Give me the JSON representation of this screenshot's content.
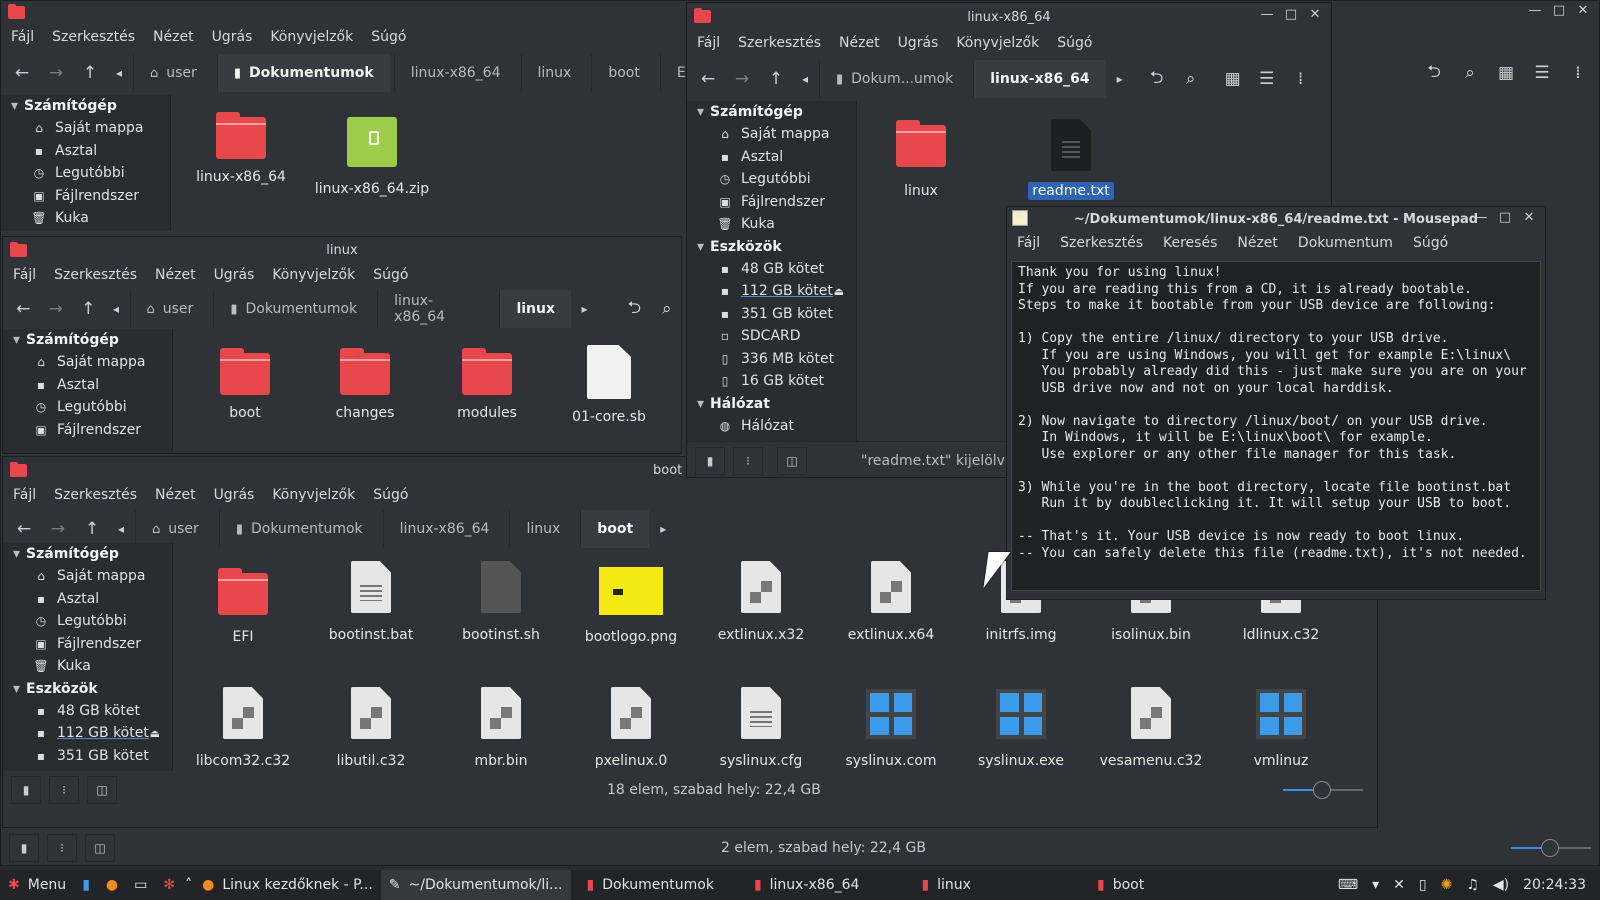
{
  "menus": [
    "Fájl",
    "Szerkesztés",
    "Nézet",
    "Ugrás",
    "Könyvjelzők",
    "Súgó"
  ],
  "win_back": {
    "path": [
      "user",
      "Dokumentumok",
      "linux-x86_64",
      "linux",
      "boot",
      "EFI"
    ],
    "sidebar": {
      "section": "Számítógép",
      "items": [
        "Saját mappa",
        "Asztal",
        "Legutóbbi",
        "Fájlrendszer",
        "Kuka"
      ]
    },
    "files": [
      {
        "name": "linux-x86_64",
        "type": "folder"
      },
      {
        "name": "linux-x86_64.zip",
        "type": "zip"
      }
    ],
    "status": "2 elem, szabad hely: 22,4 GB"
  },
  "win_linux": {
    "title": "linux",
    "path": [
      "user",
      "Dokumentumok",
      "linux-x86_64",
      "linux"
    ],
    "sidebar": {
      "section": "Számítógép",
      "items": [
        "Saját mappa",
        "Asztal",
        "Legutóbbi",
        "Fájlrendszer"
      ]
    },
    "files": [
      {
        "name": "boot",
        "type": "folder"
      },
      {
        "name": "changes",
        "type": "folder"
      },
      {
        "name": "modules",
        "type": "folder"
      },
      {
        "name": "01-core.sb",
        "type": "blank"
      }
    ]
  },
  "win_boot": {
    "title": "boot",
    "path": [
      "user",
      "Dokumentumok",
      "linux-x86_64",
      "linux",
      "boot"
    ],
    "sidebar": {
      "section": "Számítógép",
      "items": [
        "Saját mappa",
        "Asztal",
        "Legutóbbi",
        "Fájlrendszer",
        "Kuka"
      ],
      "section2": "Eszközök",
      "devices": [
        "48 GB kötet",
        "112 GB kötet",
        "351 GB kötet"
      ]
    },
    "files_row1": [
      {
        "name": "EFI",
        "type": "folder"
      },
      {
        "name": "bootinst.bat",
        "type": "lines"
      },
      {
        "name": "bootinst.sh",
        "type": "dark"
      },
      {
        "name": "bootlogo.png",
        "type": "png"
      },
      {
        "name": "extlinux.x32",
        "type": "bin"
      },
      {
        "name": "extlinux.x64",
        "type": "bin"
      },
      {
        "name": "initrfs.img",
        "type": "bin"
      },
      {
        "name": "isolinux.bin",
        "type": "bin"
      },
      {
        "name": "ldlinux.c32",
        "type": "bin"
      }
    ],
    "files_row2": [
      {
        "name": "libcom32.c32",
        "type": "bin"
      },
      {
        "name": "libutil.c32",
        "type": "bin"
      },
      {
        "name": "mbr.bin",
        "type": "bin"
      },
      {
        "name": "pxelinux.0",
        "type": "bin"
      },
      {
        "name": "syslinux.cfg",
        "type": "lines"
      },
      {
        "name": "syslinux.com",
        "type": "win"
      },
      {
        "name": "syslinux.exe",
        "type": "win"
      },
      {
        "name": "vesamenu.c32",
        "type": "bin"
      },
      {
        "name": "vmlinuz",
        "type": "win"
      }
    ],
    "status": "18 elem, szabad hely: 22,4 GB"
  },
  "win_x86": {
    "title": "linux-x86_64",
    "path": [
      "Dokum...umok",
      "linux-x86_64"
    ],
    "sidebar": {
      "section": "Számítógép",
      "items": [
        "Saját mappa",
        "Asztal",
        "Legutóbbi",
        "Fájlrendszer",
        "Kuka"
      ],
      "section2": "Eszközök",
      "devices": [
        "48 GB kötet",
        "112 GB kötet",
        "351 GB kötet",
        "SDCARD",
        "336 MB kötet",
        "16 GB kötet"
      ],
      "section3": "Hálózat",
      "network": [
        "Hálózat"
      ]
    },
    "files": [
      {
        "name": "linux",
        "type": "folder"
      },
      {
        "name": "readme.txt",
        "type": "black"
      }
    ],
    "status": "\"readme.txt\" kijelölve"
  },
  "mousepad": {
    "title": "~/Dokumentumok/linux-x86_64/readme.txt - Mousepad",
    "menus": [
      "Fájl",
      "Szerkesztés",
      "Keresés",
      "Nézet",
      "Dokumentum",
      "Súgó"
    ],
    "text": "Thank you for using linux!\nIf you are reading this from a CD, it is already bootable.\nSteps to make it bootable from your USB device are following:\n\n1) Copy the entire /linux/ directory to your USB drive.\n   If you are using Windows, you will get for example E:\\linux\\\n   You probably already did this - just make sure you are on your\n   USB drive now and not on your local harddisk.\n\n2) Now navigate to directory /linux/boot/ on your USB drive.\n   In Windows, it will be E:\\linux\\boot\\ for example.\n   Use explorer or any other file manager for this task.\n\n3) While you're in the boot directory, locate file bootinst.bat\n   Run it by doubleclicking it. It will setup your USB to boot.\n\n-- That's it. Your USB device is now ready to boot linux.\n-- You can safely delete this file (readme.txt), it's not needed."
  },
  "taskbar": {
    "menu": "Menu",
    "tasks": [
      "Linux kezdőknek - P...",
      "~/Dokumentumok/li...",
      "Dokumentumok",
      "linux-x86_64",
      "linux",
      "boot"
    ],
    "clock": "20:24:33"
  },
  "colors": {
    "folder": "#e8474b",
    "accent": "#3d8ee0",
    "zip": "#9dcc4a"
  }
}
